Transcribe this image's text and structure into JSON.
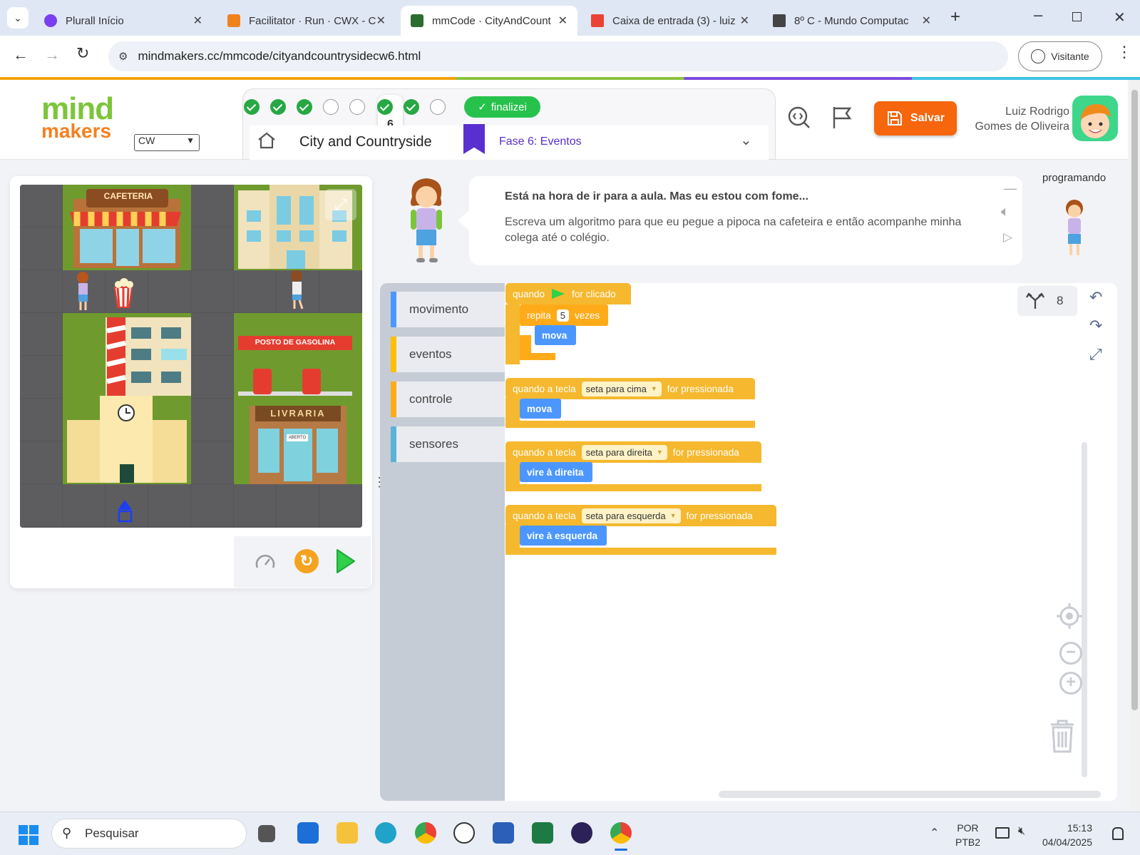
{
  "browser": {
    "tabs": [
      {
        "title": "Plurall Início",
        "color": "#7a3ff0"
      },
      {
        "title": "Facilitator · Run · CWX - C",
        "color": "#f0821e"
      },
      {
        "title": "mmCode · CityAndCount",
        "color": "#2c6d2f"
      },
      {
        "title": "Caixa de entrada (3) - luiz",
        "color": "#ea4335"
      },
      {
        "title": "8º C - Mundo Computac",
        "color": "#444444"
      }
    ],
    "url": "mindmakers.cc/mmcode/cityandcountrysidecw6.html",
    "profile": "Visitante"
  },
  "header": {
    "logo_top": "mind",
    "logo_bottom": "makers",
    "class_select": "CW",
    "current_step": "6",
    "finalizei": "finalizei",
    "level_title": "City and Countryside",
    "phase": "Fase 6: Eventos",
    "save_label": "Salvar",
    "user_name": "Luiz Rodrigo Gomes de Oliveira"
  },
  "progress": {
    "steps": [
      "done",
      "done",
      "done",
      "empty",
      "empty",
      "done",
      "done",
      "empty"
    ]
  },
  "map": {
    "cafeteria": "CAFETERIA",
    "gas_station": "POSTO DE GASOLINA",
    "bookstore": "LIVRARIA",
    "open_sign": "ABERTO"
  },
  "instructions": {
    "title": "Está na hora de ir para a aula. Mas eu estou com fome...",
    "body": "Escreva um algoritmo para que eu pegue a pipoca na cafeteira e então acompanhe minha colega até o colégio.",
    "status": "programando"
  },
  "toolbox": [
    {
      "label": "movimento",
      "color": "#4c97ff"
    },
    {
      "label": "eventos",
      "color": "#ffbf00"
    },
    {
      "label": "controle",
      "color": "#ffab19"
    },
    {
      "label": "sensores",
      "color": "#5cb1d6"
    }
  ],
  "blocks": {
    "when_clicked": "quando",
    "for_clicked": "for clicado",
    "repeat": "repita",
    "repeat_times": "5",
    "times": "vezes",
    "move": "mova",
    "when_key": "quando a tecla",
    "pressed": "for pressionada",
    "key_up": "seta para cima",
    "key_right": "seta para direita",
    "key_left": "seta para esquerda",
    "turn_right": "vire à direita",
    "turn_left": "vire à esquerda"
  },
  "editor": {
    "block_count": "8"
  },
  "taskbar": {
    "search": "Pesquisar",
    "lang1": "POR",
    "lang2": "PTB2",
    "time": "15:13",
    "date": "04/04/2025"
  }
}
